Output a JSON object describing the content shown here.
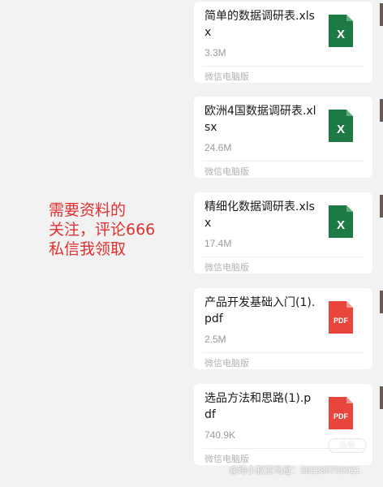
{
  "promo": {
    "lines": [
      "需要资料的",
      "关注，评论666",
      "私信我领取"
    ]
  },
  "files": [
    {
      "name": "简单的数据调研表.xlsx",
      "size": "3.3M",
      "source": "微信电脑版",
      "type": "xlsx",
      "icon": "excel-file-icon",
      "icon_label": "X"
    },
    {
      "name": "欧洲4国数据调研表.xlsx",
      "size": "24.6M",
      "source": "微信电脑版",
      "type": "xlsx",
      "icon": "excel-file-icon",
      "icon_label": "X"
    },
    {
      "name": "精细化数据调研表.xlsx",
      "size": "17.4M",
      "source": "微信电脑版",
      "type": "xlsx",
      "icon": "excel-file-icon",
      "icon_label": "X"
    },
    {
      "name": "产品开发基础入门(1).pdf",
      "size": "2.5M",
      "source": "微信电脑版",
      "type": "pdf",
      "icon": "pdf-file-icon",
      "icon_label": "PDF"
    },
    {
      "name": "选品方法和思路(1).pdf",
      "size": "740.9K",
      "source": "微信电脑版",
      "type": "pdf",
      "icon": "pdf-file-icon",
      "icon_label": "PDF"
    }
  ],
  "watermark": {
    "badge": "头条",
    "footer": "@跨小叔亚马逊：382285700021"
  },
  "colors": {
    "excel": "#1e7a45",
    "pdf": "#e8453c",
    "promo_text": "#e0302f"
  }
}
